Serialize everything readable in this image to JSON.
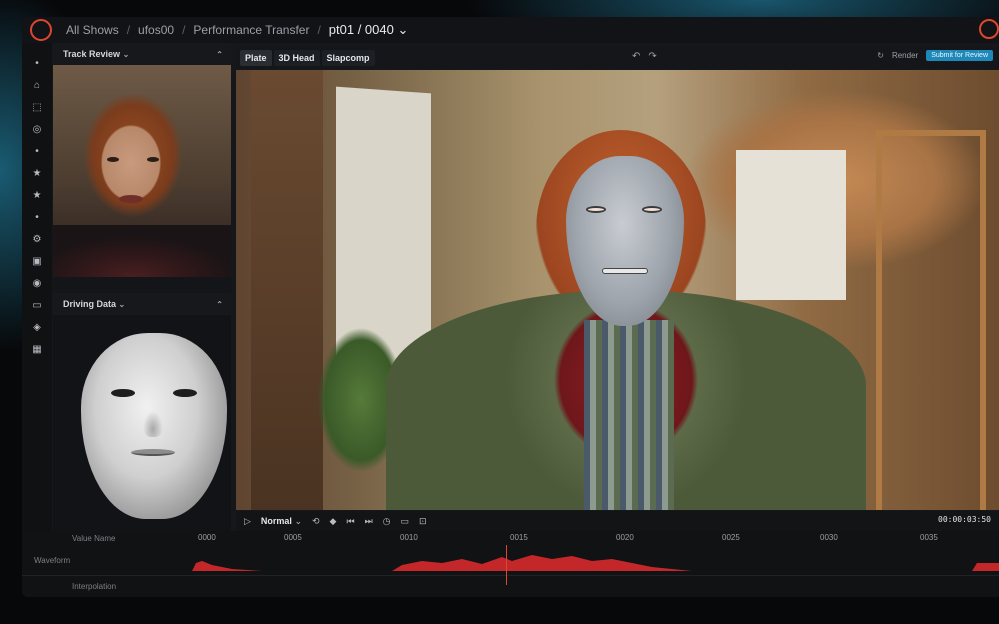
{
  "breadcrumb": [
    "All Shows",
    "ufos00",
    "Performance Transfer"
  ],
  "breadcrumb_current": "pt01 / 0040",
  "panels": {
    "track_review": "Track Review",
    "driving_data": "Driving Data"
  },
  "viewer_tabs": [
    "Plate",
    "3D Head",
    "Slapcomp"
  ],
  "render_label": "Render",
  "submit_label": "Submit for Review",
  "controls": {
    "speed": "Normal",
    "timecode": "00:00:03:50"
  },
  "timeline": {
    "ticks": [
      "0000",
      "0005",
      "0010",
      "0015",
      "0020",
      "0025",
      "0030",
      "0035"
    ],
    "rows": [
      "Value Name",
      "Waveform",
      "Interpolation"
    ]
  },
  "colors": {
    "accent": "#1e88b8",
    "brand": "#e0452f",
    "waveform": "#c3272a"
  }
}
